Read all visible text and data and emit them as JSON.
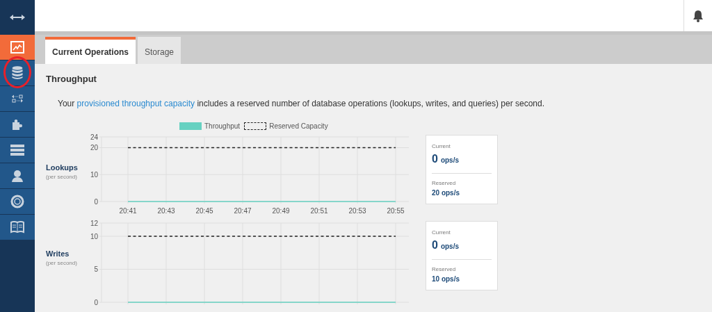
{
  "sidebar": {
    "items": [
      {
        "kind": "toggle",
        "selected": false
      },
      {
        "kind": "chart",
        "selected": true
      },
      {
        "kind": "database",
        "selected": false,
        "highlighted": true
      },
      {
        "kind": "transfer",
        "selected": false
      },
      {
        "kind": "puzzle",
        "selected": false
      },
      {
        "kind": "servers",
        "selected": false
      },
      {
        "kind": "user",
        "selected": false
      },
      {
        "kind": "lifebuoy",
        "selected": false
      },
      {
        "kind": "book",
        "selected": false
      }
    ]
  },
  "tabs": [
    {
      "label": "Current Operations",
      "selected": true
    },
    {
      "label": "Storage",
      "selected": false
    }
  ],
  "section_title": "Throughput",
  "intro": {
    "before": "Your",
    "link": "provisioned throughput capacity",
    "after": "includes a reserved number of database operations (lookups, writes, and queries) per second."
  },
  "metrics": [
    {
      "title": "Lookups",
      "subtitle": "(per second)",
      "card": {
        "current_label": "Current",
        "current_value": "0",
        "current_unit": "ops/s",
        "reserved_label": "Reserved",
        "reserved_value": "20 ops/s"
      },
      "chart_data": {
        "type": "line",
        "categories": [
          "20:41",
          "20:43",
          "20:45",
          "20:47",
          "20:49",
          "20:51",
          "20:53",
          "20:55"
        ],
        "ylim": [
          0,
          24
        ],
        "yticks": [
          0,
          10,
          20,
          24
        ],
        "grid": true,
        "series": [
          {
            "name": "Throughput",
            "color": "#66d1c1",
            "line_style": "solid",
            "values": [
              0,
              0,
              0,
              0,
              0,
              0,
              0,
              0
            ]
          },
          {
            "name": "Reserved Capacity",
            "color": "#222222",
            "line_style": "dashed",
            "values": [
              20,
              20,
              20,
              20,
              20,
              20,
              20,
              20
            ]
          }
        ]
      }
    },
    {
      "title": "Writes",
      "subtitle": "(per second)",
      "card": {
        "current_label": "Current",
        "current_value": "0",
        "current_unit": "ops/s",
        "reserved_label": "Reserved",
        "reserved_value": "10 ops/s"
      },
      "chart_data": {
        "type": "line",
        "ylim": [
          0,
          12
        ],
        "yticks": [
          0,
          5,
          10,
          12
        ],
        "grid": true,
        "series": [
          {
            "color": "#66d1c1",
            "line_style": "solid",
            "values": [
              0,
              0,
              0,
              0,
              0,
              0,
              0,
              0
            ]
          },
          {
            "color": "#222222",
            "line_style": "dashed",
            "values": [
              10,
              10,
              10,
              10,
              10,
              10,
              10,
              10
            ]
          }
        ]
      }
    }
  ]
}
